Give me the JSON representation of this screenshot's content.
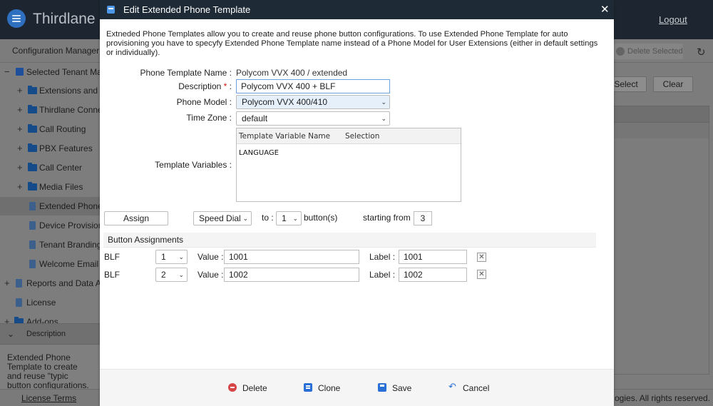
{
  "app": {
    "logo_text": "Thirdlane",
    "logout": "Logout",
    "config_manager_title": "Configuration Manager 10.",
    "delete_selected": "Delete Selected",
    "select_btn": "Select",
    "clear_btn": "Clear",
    "tree": [
      {
        "toggle": "−",
        "label": "Selected Tenant Mar",
        "icon": "tenant-icon"
      },
      {
        "toggle": "+",
        "label": "Extensions and C",
        "icon": "folder-icon"
      },
      {
        "toggle": "+",
        "label": "Thirdlane Conne",
        "icon": "folder-icon"
      },
      {
        "toggle": "+",
        "label": "Call Routing",
        "icon": "folder-icon"
      },
      {
        "toggle": "+",
        "label": "PBX Features",
        "icon": "folder-icon"
      },
      {
        "toggle": "+",
        "label": "Call Center",
        "icon": "folder-icon"
      },
      {
        "toggle": "+",
        "label": "Media Files",
        "icon": "folder-icon"
      },
      {
        "toggle": "",
        "label": "Extended Phone",
        "icon": "document-icon"
      },
      {
        "toggle": "",
        "label": "Device Provision",
        "icon": "document-icon"
      },
      {
        "toggle": "",
        "label": "Tenant Branding",
        "icon": "document-icon"
      },
      {
        "toggle": "",
        "label": "Welcome Email",
        "icon": "document-icon"
      },
      {
        "toggle": "+",
        "label": "Reports and Data Ar",
        "icon": "document-icon"
      },
      {
        "toggle": "",
        "label": "License",
        "icon": "document-icon"
      },
      {
        "toggle": "+",
        "label": "Add-ons",
        "icon": "folder-icon"
      }
    ],
    "description_header": "Description",
    "description_text": "Extended Phone Template to create and reuse \"typic button configurations.",
    "license_terms": "License Terms",
    "copyright": "ogies. All rights reserved."
  },
  "modal": {
    "title": "Edit Extended Phone Template",
    "intro": "Extneded Phone Templates allow you to create and reuse phone button configurations. To use Extended Phone Template for auto provisioning you have to specyfy Extended Phone Template name instead of a Phone Model for User Extensions (either in default settings or individually).",
    "fields": {
      "template_name_label": "Phone Template Name :",
      "template_name_value": "Polycom VVX 400 / extended",
      "description_label": "Description",
      "description_required": "*",
      "description_colon": ":",
      "description_value": "Polycom VVX 400 + BLF",
      "phone_model_label": "Phone Model :",
      "phone_model_value": "Polycom VVX 400/410",
      "time_zone_label": "Time Zone :",
      "time_zone_value": "default",
      "template_vars_label": "Template Variables :"
    },
    "template_variables": {
      "col_name": "Template Variable Name",
      "col_selection": "Selection",
      "rows": [
        {
          "name": "LANGUAGE",
          "selection": ""
        }
      ]
    },
    "assign": {
      "button": "Assign",
      "type_value": "Speed Dial",
      "to_label": "to :",
      "count_value": "1",
      "buttons_label": "button(s)",
      "starting_label": "starting from :",
      "starting_value": "3"
    },
    "button_assignments": {
      "header": "Button Assignments",
      "value_label": "Value :",
      "label_label": "Label :",
      "rows": [
        {
          "type": "BLF",
          "index": "1",
          "value": "1001",
          "label": "1001"
        },
        {
          "type": "BLF",
          "index": "2",
          "value": "1002",
          "label": "1002"
        }
      ]
    },
    "footer": {
      "delete": "Delete",
      "clone": "Clone",
      "save": "Save",
      "cancel": "Cancel"
    }
  }
}
